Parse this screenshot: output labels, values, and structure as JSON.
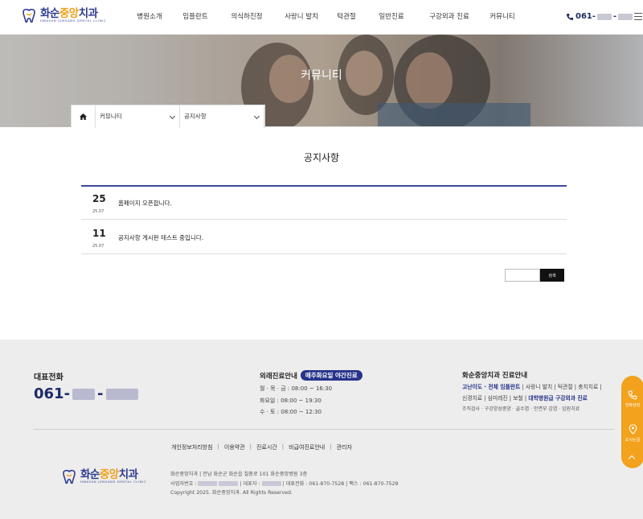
{
  "header": {
    "logo": {
      "text_main": "화순",
      "text_accent": "중앙",
      "text_tail": "치과",
      "subtitle": "HWASUN JUNGANG DENTAL CLINIC"
    },
    "nav": [
      "병원소개",
      "임플란트",
      "의식하진정",
      "사랑니 발치",
      "턱관절",
      "일반진료",
      "구강외과 진료",
      "커뮤니티"
    ],
    "phone": {
      "prefix": "061-",
      "sep": "-"
    }
  },
  "hero": {
    "title": "커뮤니티"
  },
  "breadcrumb": {
    "level1": "커뮤니티",
    "level2": "공지사항"
  },
  "board": {
    "title": "공지사항",
    "posts": [
      {
        "day": "25",
        "ym": "25.07",
        "title": "홈페이지 오픈합니다."
      },
      {
        "day": "11",
        "ym": "25.07",
        "title": "공지사항 게시판 테스트 중입니다."
      }
    ],
    "search_button": "검색"
  },
  "footer": {
    "rep_title": "대표전화",
    "rep_prefix": "061-",
    "rep_sep": "-",
    "outpatient_title": "외래진료안내",
    "outpatient_badge": "매주화요일 야간진료",
    "hours": [
      "월 · 목 · 금 : 08:00 ~ 16:30",
      "화요일 : 08:00 ~ 19:30",
      "수 · 토 : 08:00 ~ 12:30"
    ],
    "care_title": "화순중앙치과 진료안내",
    "care_line1_hl": "고난이도 · 전체 임플란트",
    "care_line1_rest": " | 사랑니 발치 | 턱관절 | 충치치료 |",
    "care_line2_a": "신경치료 | 심미레진 | 보철 | ",
    "care_line2_hl": "대학병원급 구강외과 진료",
    "care_line3": "조직검사 · 구강양성종양 · 골수염 · 안면부 감염 · 입원치료",
    "links": [
      "개인정보처리방침",
      "이용약관",
      "진료시간",
      "비급여진료안내",
      "관리자"
    ],
    "info_line1": "화순중앙치과  |  전남 화순군 화순읍 칠충로 101 화순중앙병원 3층",
    "info_biz": "사업자번호 :",
    "info_ceo": "|  대표자 :",
    "info_tel": "|  대표전화 : 061-870-7528  |  팩스 : 061-870-7529",
    "copyright": "Copyright 2025. 화순중앙치과. All Rights Reserved."
  },
  "quick": {
    "call": "전화상담",
    "map": "오시는길"
  },
  "colors": {
    "brand_navy": "#2f3b8f",
    "brand_orange": "#f0a21c",
    "quick_bar": "#f2a21d"
  }
}
